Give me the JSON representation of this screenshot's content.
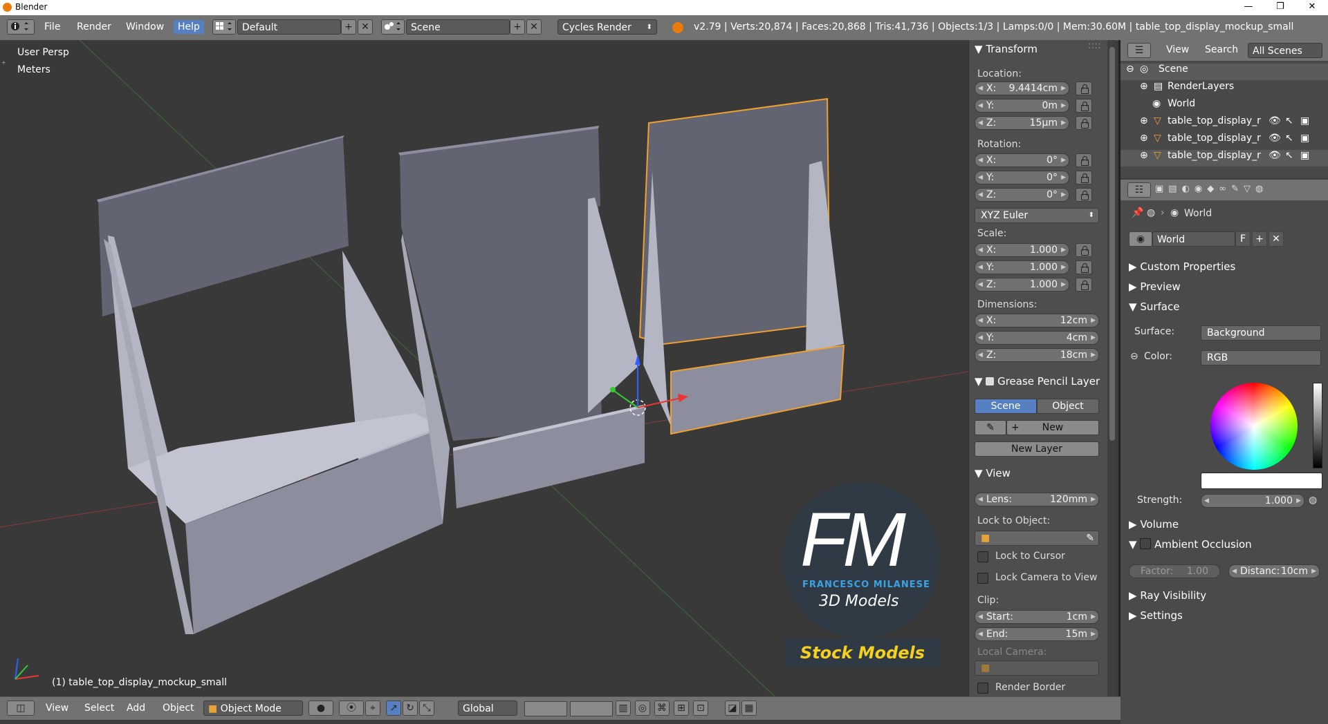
{
  "window": {
    "title": "Blender",
    "controls": [
      "—",
      "❒",
      "✕"
    ]
  },
  "header": {
    "menus": [
      "File",
      "Render",
      "Window",
      "Help"
    ],
    "layout": "Default",
    "scene": "Scene",
    "engine": "Cycles Render",
    "stats": "v2.79 | Verts:20,874 | Faces:20,868 | Tris:41,736 | Objects:1/3 | Lamps:0/0 | Mem:30.60M | table_top_display_mockup_small"
  },
  "viewport": {
    "view_name": "User Persp",
    "units": "Meters",
    "active_object": "(1) table_top_display_mockup_small",
    "watermark": {
      "letters": "FM",
      "name": "FRANCESCO MILANESE",
      "line": "3D Models",
      "badge": "Stock Models"
    }
  },
  "npanel": {
    "transform_title": "Transform",
    "location_label": "Location:",
    "location": [
      {
        "k": "X:",
        "v": "9.4414cm"
      },
      {
        "k": "Y:",
        "v": "0m"
      },
      {
        "k": "Z:",
        "v": "15µm"
      }
    ],
    "rotation_label": "Rotation:",
    "rotation": [
      {
        "k": "X:",
        "v": "0°"
      },
      {
        "k": "Y:",
        "v": "0°"
      },
      {
        "k": "Z:",
        "v": "0°"
      }
    ],
    "rotation_mode": "XYZ Euler",
    "scale_label": "Scale:",
    "scale": [
      {
        "k": "X:",
        "v": "1.000"
      },
      {
        "k": "Y:",
        "v": "1.000"
      },
      {
        "k": "Z:",
        "v": "1.000"
      }
    ],
    "dimensions_label": "Dimensions:",
    "dimensions": [
      {
        "k": "X:",
        "v": "12cm"
      },
      {
        "k": "Y:",
        "v": "4cm"
      },
      {
        "k": "Z:",
        "v": "18cm"
      }
    ],
    "grease_title": "Grease Pencil Layer",
    "grease_scene": "Scene",
    "grease_object": "Object",
    "new": "New",
    "new_layer": "New Layer",
    "view_title": "View",
    "lens_label": "Lens:",
    "lens_value": "120mm",
    "lock_object_label": "Lock to Object:",
    "lock_cursor": "Lock to Cursor",
    "lock_camera": "Lock Camera to View",
    "clip_label": "Clip:",
    "clip_start_label": "Start:",
    "clip_start": "1cm",
    "clip_end_label": "End:",
    "clip_end": "15m",
    "local_camera_label": "Local Camera:",
    "render_border": "Render Border"
  },
  "outliner": {
    "menus": [
      "View",
      "Search"
    ],
    "filter": "All Scenes",
    "items": [
      {
        "label": "Scene"
      },
      {
        "label": "RenderLayers"
      },
      {
        "label": "World"
      },
      {
        "label": "table_top_display_r"
      },
      {
        "label": "table_top_display_r"
      },
      {
        "label": "table_top_display_r"
      }
    ]
  },
  "properties": {
    "breadcrumb": "World",
    "world_name": "World",
    "fake_user": "F",
    "panels": {
      "custom_properties": "Custom Properties",
      "preview": "Preview",
      "surface": "Surface",
      "volume": "Volume",
      "ambient_occlusion": "Ambient Occlusion",
      "ray_visibility": "Ray Visibility",
      "settings": "Settings"
    },
    "surface_label": "Surface:",
    "surface_value": "Background",
    "color_label": "Color:",
    "color_value": "RGB",
    "strength_label": "Strength:",
    "strength_value": "1.000",
    "factor_label": "Factor:",
    "factor_value": "1.00",
    "distance_label": "Distanc:",
    "distance_value": "10cm"
  },
  "bottombar": {
    "menus": [
      "View",
      "Select",
      "Add",
      "Object"
    ],
    "mode": "Object Mode",
    "orientation": "Global"
  },
  "colors": {
    "accent": "#5680c2",
    "header": "#727272",
    "viewport": "#393939",
    "selection": "#f0a030",
    "watermark_blue": "#3aa3e3",
    "badge_text": "#f5d01c"
  }
}
